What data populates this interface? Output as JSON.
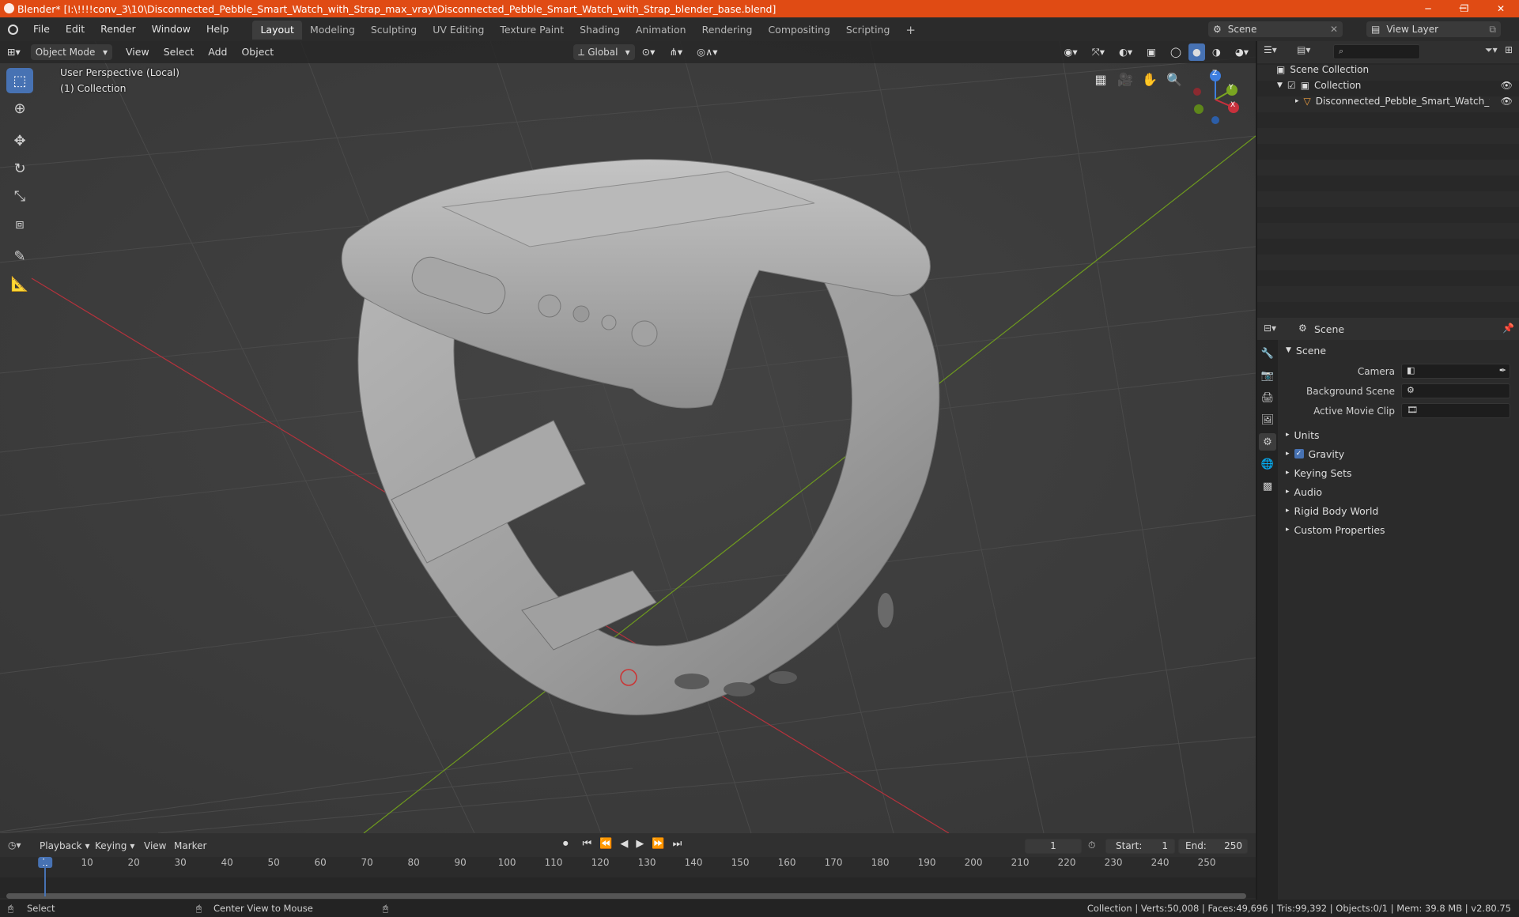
{
  "window": {
    "title": "Blender* [I:\\!!!!conv_3\\10\\Disconnected_Pebble_Smart_Watch_with_Strap_max_vray\\Disconnected_Pebble_Smart_Watch_with_Strap_blender_base.blend]",
    "minimize": "─",
    "maximize": "❐",
    "close": "✕"
  },
  "menu": [
    "File",
    "Edit",
    "Render",
    "Window",
    "Help"
  ],
  "workspaces": [
    "Layout",
    "Modeling",
    "Sculpting",
    "UV Editing",
    "Texture Paint",
    "Shading",
    "Animation",
    "Rendering",
    "Compositing",
    "Scripting"
  ],
  "add_tab": "+",
  "scene_selector": {
    "label": "Scene"
  },
  "view_layer": {
    "label": "View Layer"
  },
  "viewport": {
    "mode": "Object Mode",
    "menus": [
      "View",
      "Select",
      "Add",
      "Object"
    ],
    "transform_orientation": "Global",
    "overlay_line1": "User Perspective (Local)",
    "overlay_line2": "(1) Collection",
    "gizmo": {
      "x": "X",
      "y": "Y",
      "z": "Z"
    }
  },
  "outliner": {
    "root": "Scene Collection",
    "collection": "Collection",
    "object": "Disconnected_Pebble_Smart_Watch_with_St"
  },
  "properties": {
    "context": "Scene",
    "panel": "Scene",
    "fields": {
      "camera": "Camera",
      "background_scene": "Background Scene",
      "active_movie_clip": "Active Movie Clip"
    },
    "sections": [
      "Units",
      "Gravity",
      "Keying Sets",
      "Audio",
      "Rigid Body World",
      "Custom Properties"
    ]
  },
  "timeline": {
    "menus": [
      "Playback",
      "Keying",
      "View",
      "Marker"
    ],
    "current_frame": "1",
    "start_label": "Start:",
    "start": "1",
    "end_label": "End:",
    "end": "250",
    "ticks": [
      "1",
      "10",
      "20",
      "30",
      "40",
      "50",
      "60",
      "70",
      "80",
      "90",
      "100",
      "110",
      "120",
      "130",
      "140",
      "150",
      "160",
      "170",
      "180",
      "190",
      "200",
      "210",
      "220",
      "230",
      "240",
      "250"
    ]
  },
  "statusbar": {
    "left": "Select",
    "middle": "Center View to Mouse",
    "right": "Collection | Verts:50,008 | Faces:49,696 | Tris:99,392 | Objects:0/1 | Mem: 39.8 MB | v2.80.75"
  },
  "colors": {
    "accent": "#4772b3",
    "titlebar": "#e04b14",
    "x_axis": "#c8303c",
    "y_axis": "#7aa521",
    "z_axis": "#3d7ee0"
  }
}
